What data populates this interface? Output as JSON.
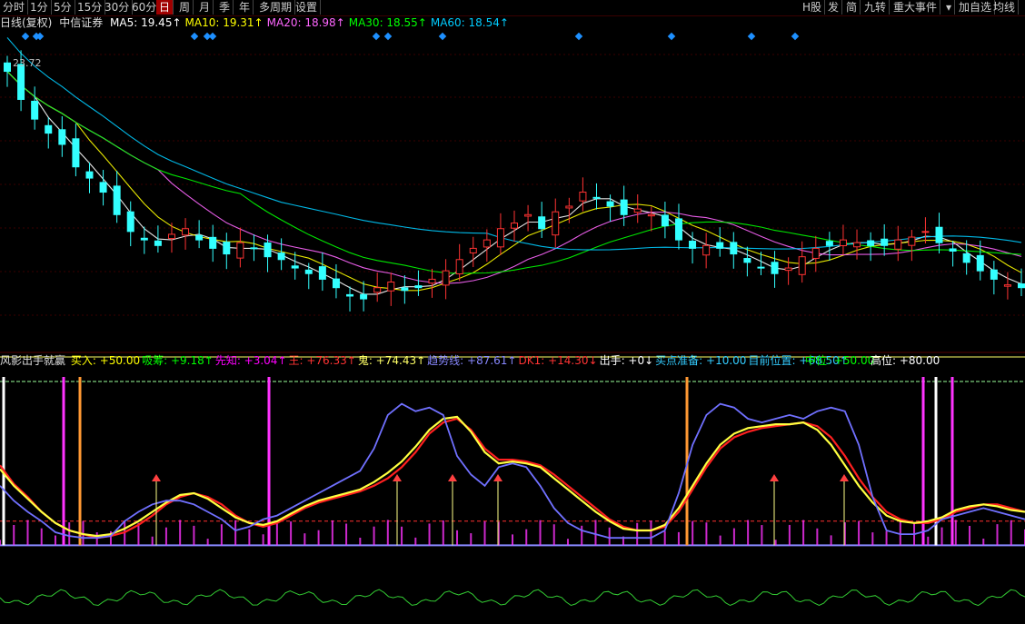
{
  "toolbar_left": [
    "分时",
    "1分",
    "5分",
    "15分",
    "30分",
    "60分",
    "日",
    "周",
    "月",
    "季",
    "年",
    "多周期",
    "设置"
  ],
  "toolbar_active": "日",
  "toolbar_right": [
    "H股",
    "发",
    "简",
    "九转",
    "重大事件",
    "▾",
    "加自选",
    "均线"
  ],
  "header": {
    "period_label": "日线(复权)",
    "stock_name": "中信证券",
    "ma": [
      {
        "label": "MA5: 19.45↑",
        "color": "#ffffff"
      },
      {
        "label": "MA10: 19.31↑",
        "color": "#ffff00"
      },
      {
        "label": "MA20: 18.98↑",
        "color": "#ff66ff"
      },
      {
        "label": "MA30: 18.55↑",
        "color": "#00ff00"
      },
      {
        "label": "MA60: 18.54↑",
        "color": "#00ccff"
      }
    ]
  },
  "indicator": {
    "name": "风影出手就赢",
    "items": [
      {
        "label": "买入: +50.00",
        "color": "#ffff00"
      },
      {
        "label": "吸筹: +9.18↑",
        "color": "#00ff00"
      },
      {
        "label": "先知: +3.04↑",
        "color": "#ff00ff"
      },
      {
        "label": "王: +76.33↑",
        "color": "#ff3333"
      },
      {
        "label": "鬼: +74.43↑",
        "color": "#ffff66"
      },
      {
        "label": "趋势线: +87.61↑",
        "color": "#8888ff"
      },
      {
        "label": "DK1: +14.30↓",
        "color": "#ff3333"
      },
      {
        "label": "出手: +0↓",
        "color": "#ffffff"
      },
      {
        "label": "买点准备: +10.00",
        "color": "#33ccff"
      },
      {
        "label": "目前位置: +68.50↑",
        "color": "#33ccff"
      }
    ],
    "mid_label": "中位: +50.00",
    "high_label": "高位: +80.00"
  },
  "price_label": "23.72",
  "chart_data": [
    {
      "type": "candlestick",
      "title": "",
      "price_max_label": 23.72,
      "closes": [
        23.6,
        22.6,
        21.9,
        21.4,
        21.0,
        20.2,
        19.8,
        19.3,
        18.5,
        17.9,
        17.6,
        17.4,
        17.8,
        18.0,
        17.6,
        17.3,
        17.1,
        17.5,
        17.3,
        17.0,
        16.9,
        16.6,
        16.4,
        16.2,
        15.9,
        15.6,
        15.5,
        15.9,
        16.1,
        15.8,
        15.9,
        16.2,
        16.5,
        16.9,
        17.3,
        17.6,
        18.0,
        18.2,
        18.5,
        18.0,
        18.6,
        18.8,
        19.3,
        19.1,
        18.8,
        18.5,
        18.7,
        18.5,
        18.1,
        17.6,
        17.3,
        17.4,
        17.3,
        17.1,
        16.8,
        16.6,
        16.4,
        16.6,
        17.0,
        17.3,
        17.4,
        17.6,
        17.5,
        17.4,
        17.4,
        17.6,
        17.7,
        17.9,
        17.5,
        17.2,
        16.8,
        16.5,
        16.2,
        16.0,
        15.9
      ],
      "ma_series": [
        {
          "name": "MA5",
          "color": "#ffffff",
          "value": 19.45
        },
        {
          "name": "MA10",
          "color": "#ffff00",
          "value": 19.31
        },
        {
          "name": "MA20",
          "color": "#ff66ff",
          "value": 18.98
        },
        {
          "name": "MA30",
          "color": "#00ff00",
          "value": 18.55
        },
        {
          "name": "MA60",
          "color": "#00ccff",
          "value": 18.54
        }
      ]
    },
    {
      "type": "line",
      "title": "",
      "ylim": [
        0,
        100
      ],
      "levels": {
        "mid": 50,
        "high": 80
      },
      "series": [
        {
          "name": "王",
          "color": "#ff2020",
          "values": [
            55,
            45,
            38,
            30,
            24,
            20,
            18,
            16,
            17,
            19,
            23,
            28,
            34,
            38,
            40,
            38,
            34,
            28,
            24,
            22,
            24,
            28,
            32,
            35,
            37,
            39,
            41,
            44,
            48,
            54,
            62,
            72,
            78,
            80,
            74,
            64,
            58,
            58,
            57,
            55,
            50,
            44,
            38,
            32,
            26,
            22,
            20,
            20,
            22,
            30,
            42,
            54,
            64,
            70,
            73,
            75,
            76,
            77,
            78,
            76,
            70,
            60,
            48,
            38,
            30,
            26,
            24,
            24,
            26,
            30,
            32,
            34,
            34,
            32,
            30
          ]
        },
        {
          "name": "鬼",
          "color": "#ffff40",
          "values": [
            53,
            44,
            37,
            30,
            24,
            20,
            18,
            17,
            18,
            21,
            25,
            30,
            35,
            39,
            40,
            37,
            32,
            27,
            24,
            23,
            25,
            29,
            33,
            36,
            38,
            40,
            42,
            46,
            51,
            57,
            65,
            74,
            80,
            81,
            73,
            62,
            56,
            57,
            56,
            54,
            48,
            42,
            36,
            30,
            25,
            21,
            20,
            20,
            23,
            32,
            44,
            56,
            66,
            72,
            75,
            76,
            77,
            77,
            78,
            74,
            66,
            55,
            44,
            35,
            28,
            25,
            24,
            25,
            27,
            31,
            33,
            34,
            33,
            31,
            30
          ]
        },
        {
          "name": "趋势线",
          "color": "#7070ff",
          "values": [
            44,
            36,
            30,
            25,
            19,
            17,
            16,
            16,
            17,
            25,
            30,
            34,
            36,
            36,
            34,
            30,
            26,
            20,
            22,
            26,
            28,
            32,
            36,
            40,
            44,
            48,
            52,
            64,
            82,
            88,
            84,
            86,
            82,
            60,
            50,
            44,
            54,
            56,
            54,
            44,
            32,
            24,
            20,
            18,
            16,
            16,
            16,
            16,
            20,
            40,
            66,
            82,
            88,
            86,
            80,
            78,
            80,
            82,
            80,
            84,
            86,
            84,
            66,
            38,
            20,
            18,
            18,
            20,
            26,
            28,
            30,
            32,
            30,
            28,
            26
          ]
        }
      ]
    }
  ]
}
